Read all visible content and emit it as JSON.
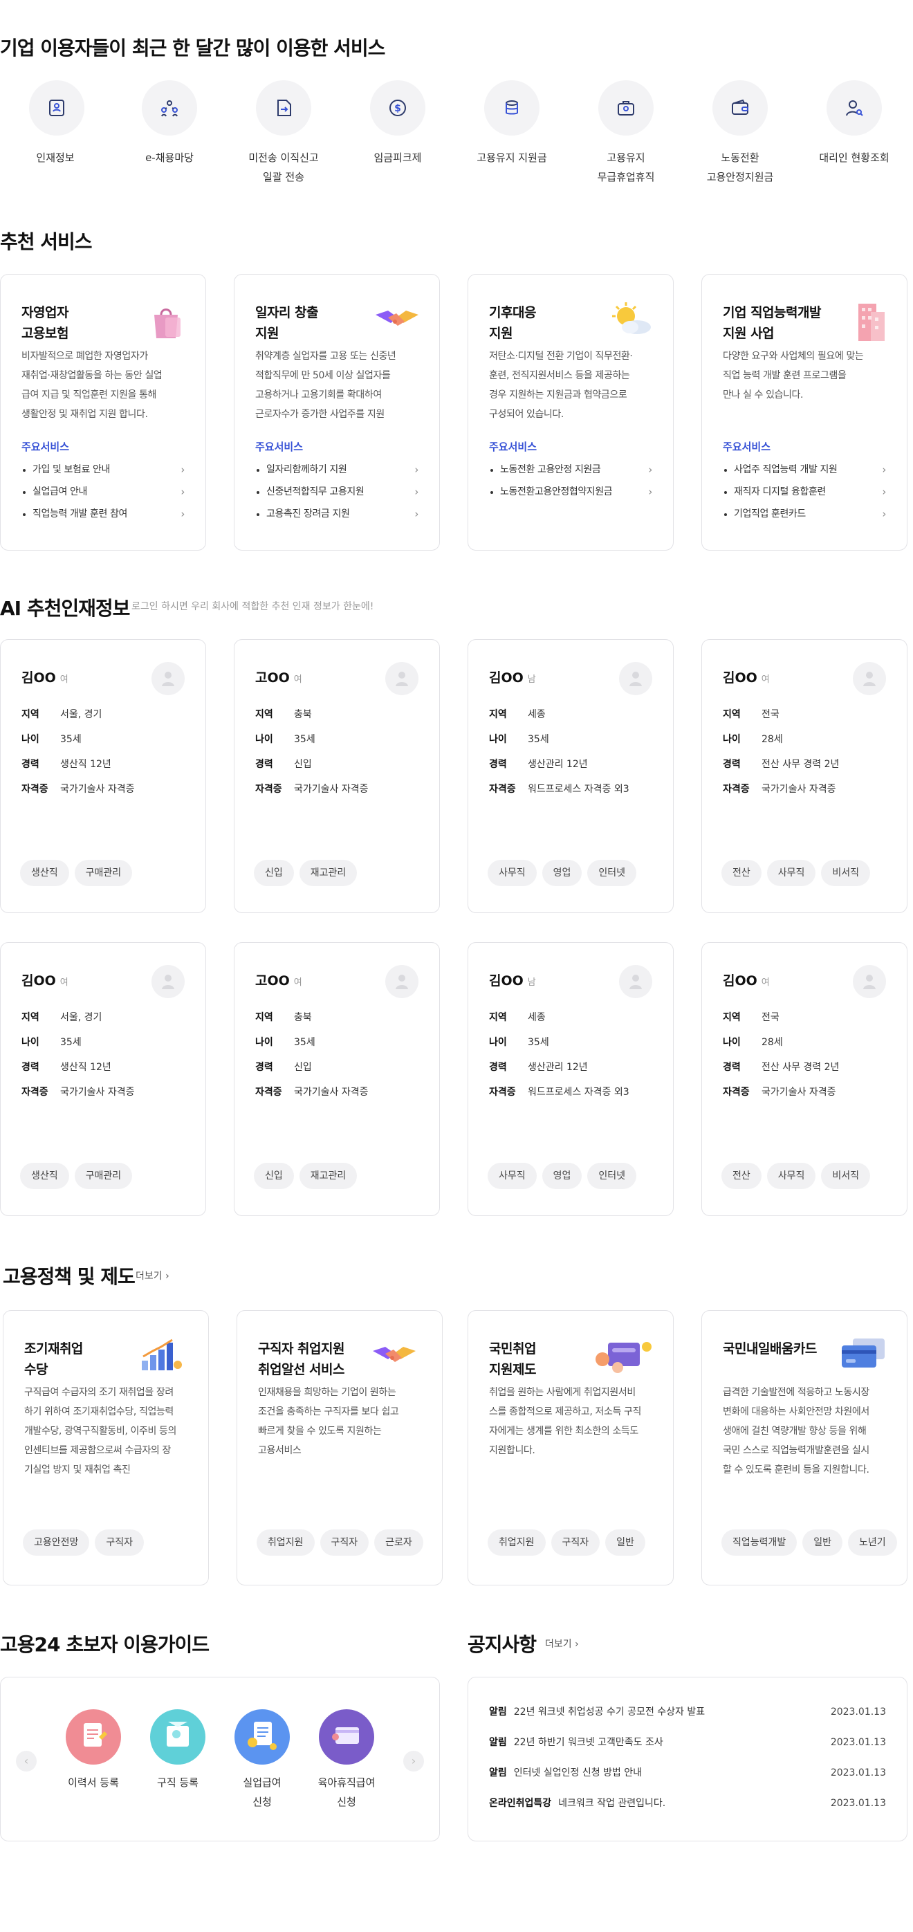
{
  "popular": {
    "title": "기업 이용자들이 최근 한 달간 많이 이용한 서비스",
    "items": [
      {
        "label": "인재정보",
        "icon": "profile-badge-icon"
      },
      {
        "label": "e-채용마당",
        "icon": "people-network-icon"
      },
      {
        "label": "미전송 이직신고\n일괄 전송",
        "icon": "document-send-icon"
      },
      {
        "label": "임금피크제",
        "icon": "dollar-circle-icon"
      },
      {
        "label": "고용유지 지원금",
        "icon": "coin-stack-icon"
      },
      {
        "label": "고용유지\n무급휴업휴직",
        "icon": "briefcase-icon"
      },
      {
        "label": "노동전환\n고용안정지원금",
        "icon": "wallet-icon"
      },
      {
        "label": "대리인 현황조회",
        "icon": "user-search-icon"
      }
    ]
  },
  "recommended": {
    "title": "추천 서비스",
    "sub_label": "주요서비스",
    "cards": [
      {
        "title": "자영업자\n고용보험",
        "desc": "비자발적으로 폐업한 자영업자가\n재취업·재창업활동을 하는 동안 실업\n급여 지급 및 직업훈련 지원을 통해\n생활안정 및 재취업 지원 합니다.",
        "items": [
          "가입 및 보험료 안내",
          "실업급여 안내",
          "직업능력 개발 훈련 참여"
        ],
        "icon": "shopping-bag-icon"
      },
      {
        "title": "일자리 창출\n지원",
        "desc": "취약계층 실업자를 고용 또는 신중년\n적합직무에 만 50세 이상 실업자를\n고용하거나 고용기회를 확대하여\n근로자수가 증가한 사업주를 지원",
        "items": [
          "일자리함께하기 지원",
          "신중년적합직무 고용지원",
          "고용촉진 장려금 지원"
        ],
        "icon": "handshake-icon"
      },
      {
        "title": "기후대응\n지원",
        "desc": "저탄소·디지털 전환 기업이 직무전환·\n훈련, 전직지원서비스 등을 제공하는\n경우 지원하는 지원금과 협약금으로\n구성되어 있습니다.",
        "items": [
          "노동전환 고용안정 지원금",
          "노동전환고용안정협약지원금"
        ],
        "icon": "sun-cloud-icon"
      },
      {
        "title": "기업 직업능력개발\n지원 사업",
        "desc": "다양한 요구와 사업체의 필요에 맞는\n직업 능력 개발 훈련 프로그램을\n만나 실 수 있습니다.",
        "items": [
          "사업주 직업능력 개발 지원",
          "재직자 디지털 융합훈련",
          "기업직업 훈련카드"
        ],
        "icon": "building-icon"
      }
    ]
  },
  "ai_talent": {
    "title": "AI 추천인재정보",
    "subtitle": "로그인 하시면 우리 회사에 적합한 추천 인재 정보가 한눈에!",
    "field_labels": {
      "region": "지역",
      "age": "나이",
      "career": "경력",
      "cert": "자격증"
    },
    "people": [
      {
        "name": "김OO",
        "gender": "여",
        "region": "서울, 경기",
        "age": "35세",
        "career": "생산직 12년",
        "cert": "국가기술사 자격증",
        "tags": [
          "생산직",
          "구매관리"
        ]
      },
      {
        "name": "고OO",
        "gender": "여",
        "region": "충북",
        "age": "35세",
        "career": "신입",
        "cert": "국가기술사 자격증",
        "tags": [
          "신입",
          "재고관리"
        ]
      },
      {
        "name": "김OO",
        "gender": "남",
        "region": "세종",
        "age": "35세",
        "career": "생산관리 12년",
        "cert": "워드프로세스 자격증 외3",
        "tags": [
          "사무직",
          "영업",
          "인터넷"
        ]
      },
      {
        "name": "김OO",
        "gender": "여",
        "region": "전국",
        "age": "28세",
        "career": "전산 사무 경력 2년",
        "cert": "국가기술사 자격증",
        "tags": [
          "전산",
          "사무직",
          "비서직"
        ]
      },
      {
        "name": "김OO",
        "gender": "여",
        "region": "서울, 경기",
        "age": "35세",
        "career": "생산직 12년",
        "cert": "국가기술사 자격증",
        "tags": [
          "생산직",
          "구매관리"
        ]
      },
      {
        "name": "고OO",
        "gender": "여",
        "region": "충북",
        "age": "35세",
        "career": "신입",
        "cert": "국가기술사 자격증",
        "tags": [
          "신입",
          "재고관리"
        ]
      },
      {
        "name": "김OO",
        "gender": "남",
        "region": "세종",
        "age": "35세",
        "career": "생산관리 12년",
        "cert": "워드프로세스 자격증 외3",
        "tags": [
          "사무직",
          "영업",
          "인터넷"
        ]
      },
      {
        "name": "김OO",
        "gender": "여",
        "region": "전국",
        "age": "28세",
        "career": "전산 사무 경력 2년",
        "cert": "국가기술사 자격증",
        "tags": [
          "전산",
          "사무직",
          "비서직"
        ]
      }
    ]
  },
  "policy": {
    "title": "고용정책 및 제도",
    "more": "더보기 ›",
    "cards": [
      {
        "title": "조기재취업\n수당",
        "desc": "구직급여 수급자의 조기 재취업을 장려\n하기 위하여 조기재취업수당, 직업능력\n개발수당, 광역구직활동비, 이주비 등의\n인센티브를 제공함으로써 수급자의 장\n기실업 방지 및 재취업 촉진",
        "tags": [
          "고용안전망",
          "구직자"
        ],
        "icon": "bar-growth-icon"
      },
      {
        "title": "구직자 취업지원\n취업알선 서비스",
        "desc": "인재채용을 희망하는 기업이 원하는\n조건을 충족하는 구직자를 보다 쉽고\n 빠르게 찾을 수 있도록 지원하는\n고용서비스",
        "tags": [
          "취업지원",
          "구직자",
          "근로자"
        ],
        "icon": "handshake-icon"
      },
      {
        "title": "국민취업\n지원제도",
        "desc": "취업을 원하는 사람에게 취업지원서비\n스를 종합적으로 제공하고, 저소득 구직\n자에게는 생계를 위한 최소한의 소득도\n지원합니다.",
        "tags": [
          "취업지원",
          "구직자",
          "일반"
        ],
        "icon": "coins-card-icon"
      },
      {
        "title": "국민내일배움카드",
        "desc": "급격한 기술발전에 적응하고 노동시장\n변화에 대응하는 사회안전망 차원에서\n생애에 걸친 역량개발 향상 등을 위해\n국민 스스로 직업능력개발훈련을 실시\n할 수 있도록 훈련비 등을 지원합니다.",
        "tags": [
          "직업능력개발",
          "일반",
          "노년기"
        ],
        "icon": "credit-card-icon"
      }
    ]
  },
  "guide": {
    "title": "고용24 초보자 이용가이드",
    "items": [
      {
        "label": "이력서 등록",
        "icon": "resume-icon",
        "color": "#f08c94"
      },
      {
        "label": "구직 등록",
        "icon": "job-search-icon",
        "color": "#5fd0d8"
      },
      {
        "label": "실업급여\n신청",
        "icon": "benefit-document-icon",
        "color": "#5b94f0"
      },
      {
        "label": "육아휴직급여\n신청",
        "icon": "parental-leave-icon",
        "color": "#7a5cc9"
      }
    ],
    "prev": "‹",
    "next": "›"
  },
  "notice": {
    "title": "공지사항",
    "more": "더보기 ›",
    "items": [
      {
        "category": "알림",
        "text": "22년 워크넷 취업성공 수기 공모전 수상자 발표",
        "date": "2023.01.13"
      },
      {
        "category": "알림",
        "text": "22년 하반기 워크넷 고객만족도 조사",
        "date": "2023.01.13"
      },
      {
        "category": "알림",
        "text": "인터넷 실업인정 신청 방법 안내",
        "date": "2023.01.13"
      },
      {
        "category": "온라인취업특강",
        "text": "네크워크 작업 관련입니다.",
        "date": "2023.01.13"
      }
    ]
  },
  "colors": {
    "accent": "#3752d6",
    "border": "#e2e2e6",
    "chip": "#f1f1f3"
  }
}
